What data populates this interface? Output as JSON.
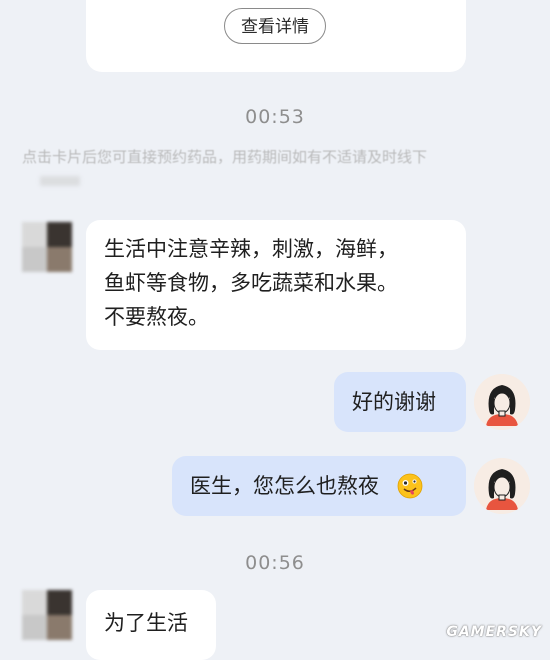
{
  "top_card": {
    "details_button": "查看详情"
  },
  "times": [
    "00:53",
    "00:56"
  ],
  "notice": "点击卡片后您可直接预约药品，用药期间如有不适请及时线下",
  "messages": [
    {
      "sender": "doctor",
      "lines": [
        "生活中注意辛辣，刺激，海鲜，",
        "鱼虾等食物，多吃蔬菜和水果。",
        "不要熬夜。"
      ]
    },
    {
      "sender": "user",
      "text": "好的谢谢"
    },
    {
      "sender": "user",
      "text": "医生，您怎么也熬夜",
      "emoji": "zany-face-emoji"
    },
    {
      "sender": "doctor",
      "text": "为了生活"
    }
  ],
  "watermark": "GAMERSKY"
}
